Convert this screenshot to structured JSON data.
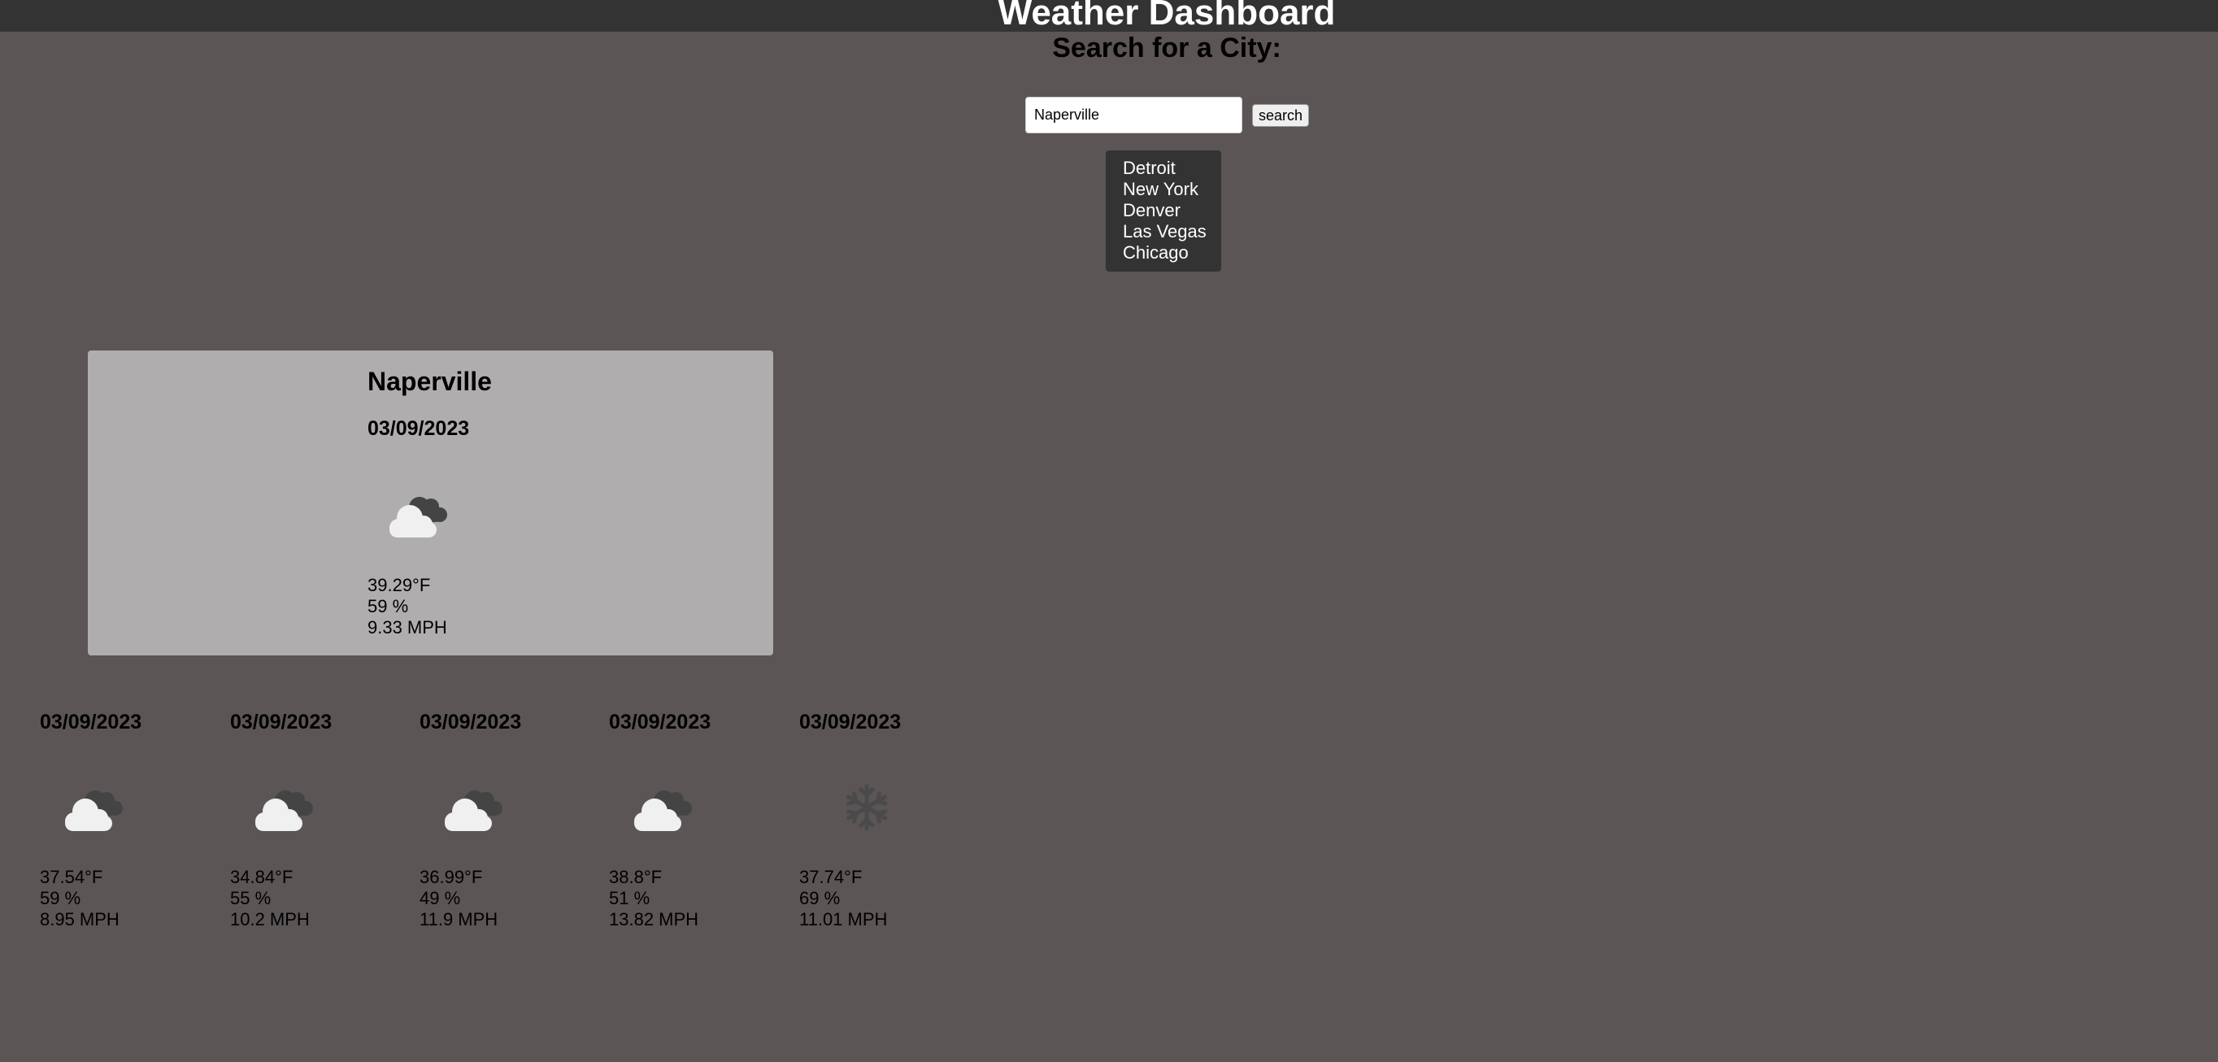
{
  "header": {
    "title": "Weather Dashboard"
  },
  "search": {
    "heading": "Search for a City:",
    "value": "Naperville",
    "button_label": "search"
  },
  "history": [
    "Detroit",
    "New York",
    "Denver",
    "Las Vegas",
    "Chicago"
  ],
  "current": {
    "city": "Naperville",
    "date": "03/09/2023",
    "icon": "broken-clouds-icon",
    "temp": "39.29°F",
    "humidity": "59 %",
    "wind": "9.33 MPH"
  },
  "forecast": [
    {
      "date": "03/09/2023",
      "icon": "broken-clouds-icon",
      "temp": "37.54°F",
      "humidity": "59 %",
      "wind": "8.95 MPH"
    },
    {
      "date": "03/09/2023",
      "icon": "broken-clouds-icon",
      "temp": "34.84°F",
      "humidity": "55 %",
      "wind": "10.2 MPH"
    },
    {
      "date": "03/09/2023",
      "icon": "broken-clouds-icon",
      "temp": "36.99°F",
      "humidity": "49 %",
      "wind": "11.9 MPH"
    },
    {
      "date": "03/09/2023",
      "icon": "broken-clouds-icon",
      "temp": "38.8°F",
      "humidity": "51 %",
      "wind": "13.82 MPH"
    },
    {
      "date": "03/09/2023",
      "icon": "snow-icon",
      "temp": "37.74°F",
      "humidity": "69 %",
      "wind": "11.01 MPH"
    }
  ],
  "colors": {
    "background": "#5b5555",
    "header": "#333333",
    "card": "#b0adae"
  }
}
